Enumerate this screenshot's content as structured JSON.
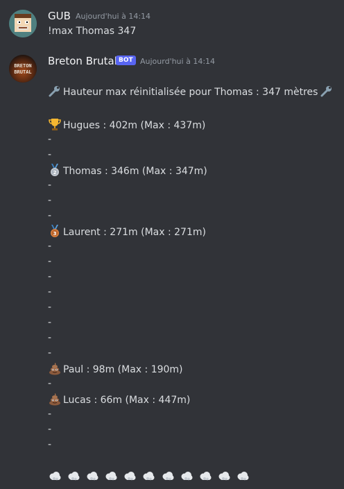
{
  "messages": [
    {
      "author": "GUB",
      "timestamp": "Aujourd'hui à 14:14",
      "content": "!max Thomas 347"
    },
    {
      "author": "Breton Brutal",
      "badge": "BOT",
      "timestamp": "Aujourd'hui à 14:14",
      "header_line": "Hauteur max réinitialisée pour Thomas : 347 mètres",
      "ranking": [
        {
          "icon": "trophy-icon",
          "text": "Hugues : 402m (Max : 437m)"
        },
        {
          "icon": "silver-medal-icon",
          "text": "Thomas : 346m (Max : 347m)"
        },
        {
          "icon": "bronze-medal-icon",
          "text": "Laurent : 271m (Max : 271m)"
        },
        {
          "icon": "poop-icon",
          "text": "Paul : 98m (Max : 190m)"
        },
        {
          "icon": "poop-icon",
          "text": "Lucas : 66m (Max : 447m)"
        }
      ],
      "dash": "-"
    }
  ],
  "avatars": {
    "gub_logo_text": "",
    "breton_logo_text": "BRETON BRUTAL"
  }
}
